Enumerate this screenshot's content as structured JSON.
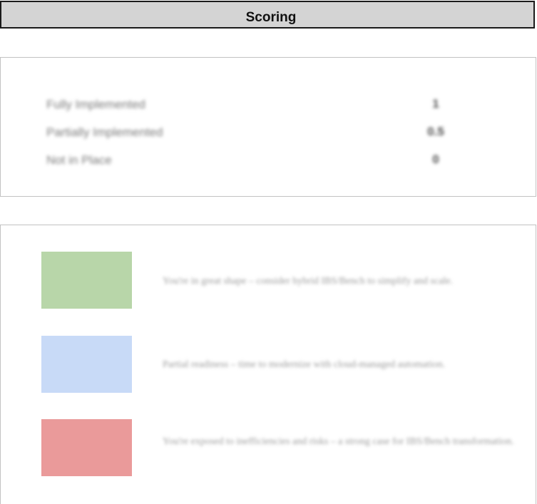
{
  "header": {
    "title": "Scoring"
  },
  "scoring": {
    "rows": [
      {
        "label": "Fully Implemented",
        "value": "1"
      },
      {
        "label": "Partially Implemented",
        "value": "0.5"
      },
      {
        "label": "Not in Place",
        "value": "0"
      }
    ]
  },
  "legend": {
    "items": [
      {
        "color": "#b8d6a9",
        "text": "You're in great shape – consider hybrid IBS/Bench to simplify and scale."
      },
      {
        "color": "#c8daf7",
        "text": "Partial readiness – time to modernize with cloud-managed automation."
      },
      {
        "color": "#ea9a9a",
        "text": "You're exposed to inefficiencies and risks – a strong case for IBS/Bench transformation."
      }
    ]
  }
}
